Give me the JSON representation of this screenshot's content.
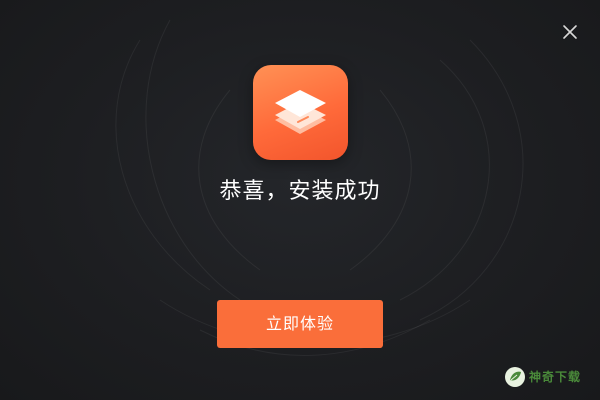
{
  "dialog": {
    "close_icon": "close-icon",
    "app_icon": "layers-app-icon",
    "title": "恭喜，安装成功",
    "primary_button_label": "立即体验",
    "accent_color": "#fa6e3a",
    "background_color": "#1d1e21"
  },
  "watermark": {
    "text": "神奇下载",
    "icon": "leaf-logo-icon",
    "color": "#4a8a3a"
  }
}
